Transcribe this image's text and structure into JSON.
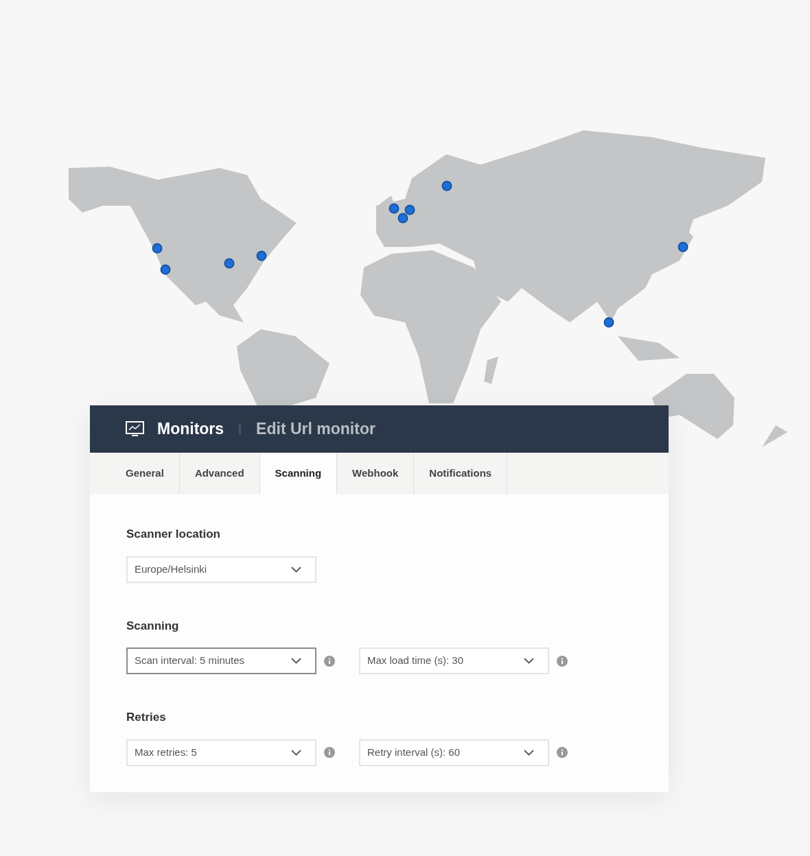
{
  "header": {
    "section": "Monitors",
    "page": "Edit Url monitor"
  },
  "tabs": [
    {
      "label": "General",
      "selected": false
    },
    {
      "label": "Advanced",
      "selected": false
    },
    {
      "label": "Scanning",
      "selected": true
    },
    {
      "label": "Webhook",
      "selected": false
    },
    {
      "label": "Notifications",
      "selected": false
    }
  ],
  "groups": [
    {
      "title": "Scanner location",
      "fields": [
        {
          "value": "Europe/Helsinki",
          "focused": false,
          "info": false
        }
      ]
    },
    {
      "title": "Scanning",
      "fields": [
        {
          "value": "Scan interval: 5 minutes",
          "focused": true,
          "info": true
        },
        {
          "value": "Max load time (s): 30",
          "focused": false,
          "info": true
        }
      ]
    },
    {
      "title": "Retries",
      "fields": [
        {
          "value": "Max retries: 5",
          "focused": false,
          "info": true
        },
        {
          "value": "Retry interval (s): 60",
          "focused": false,
          "info": true
        }
      ]
    }
  ]
}
